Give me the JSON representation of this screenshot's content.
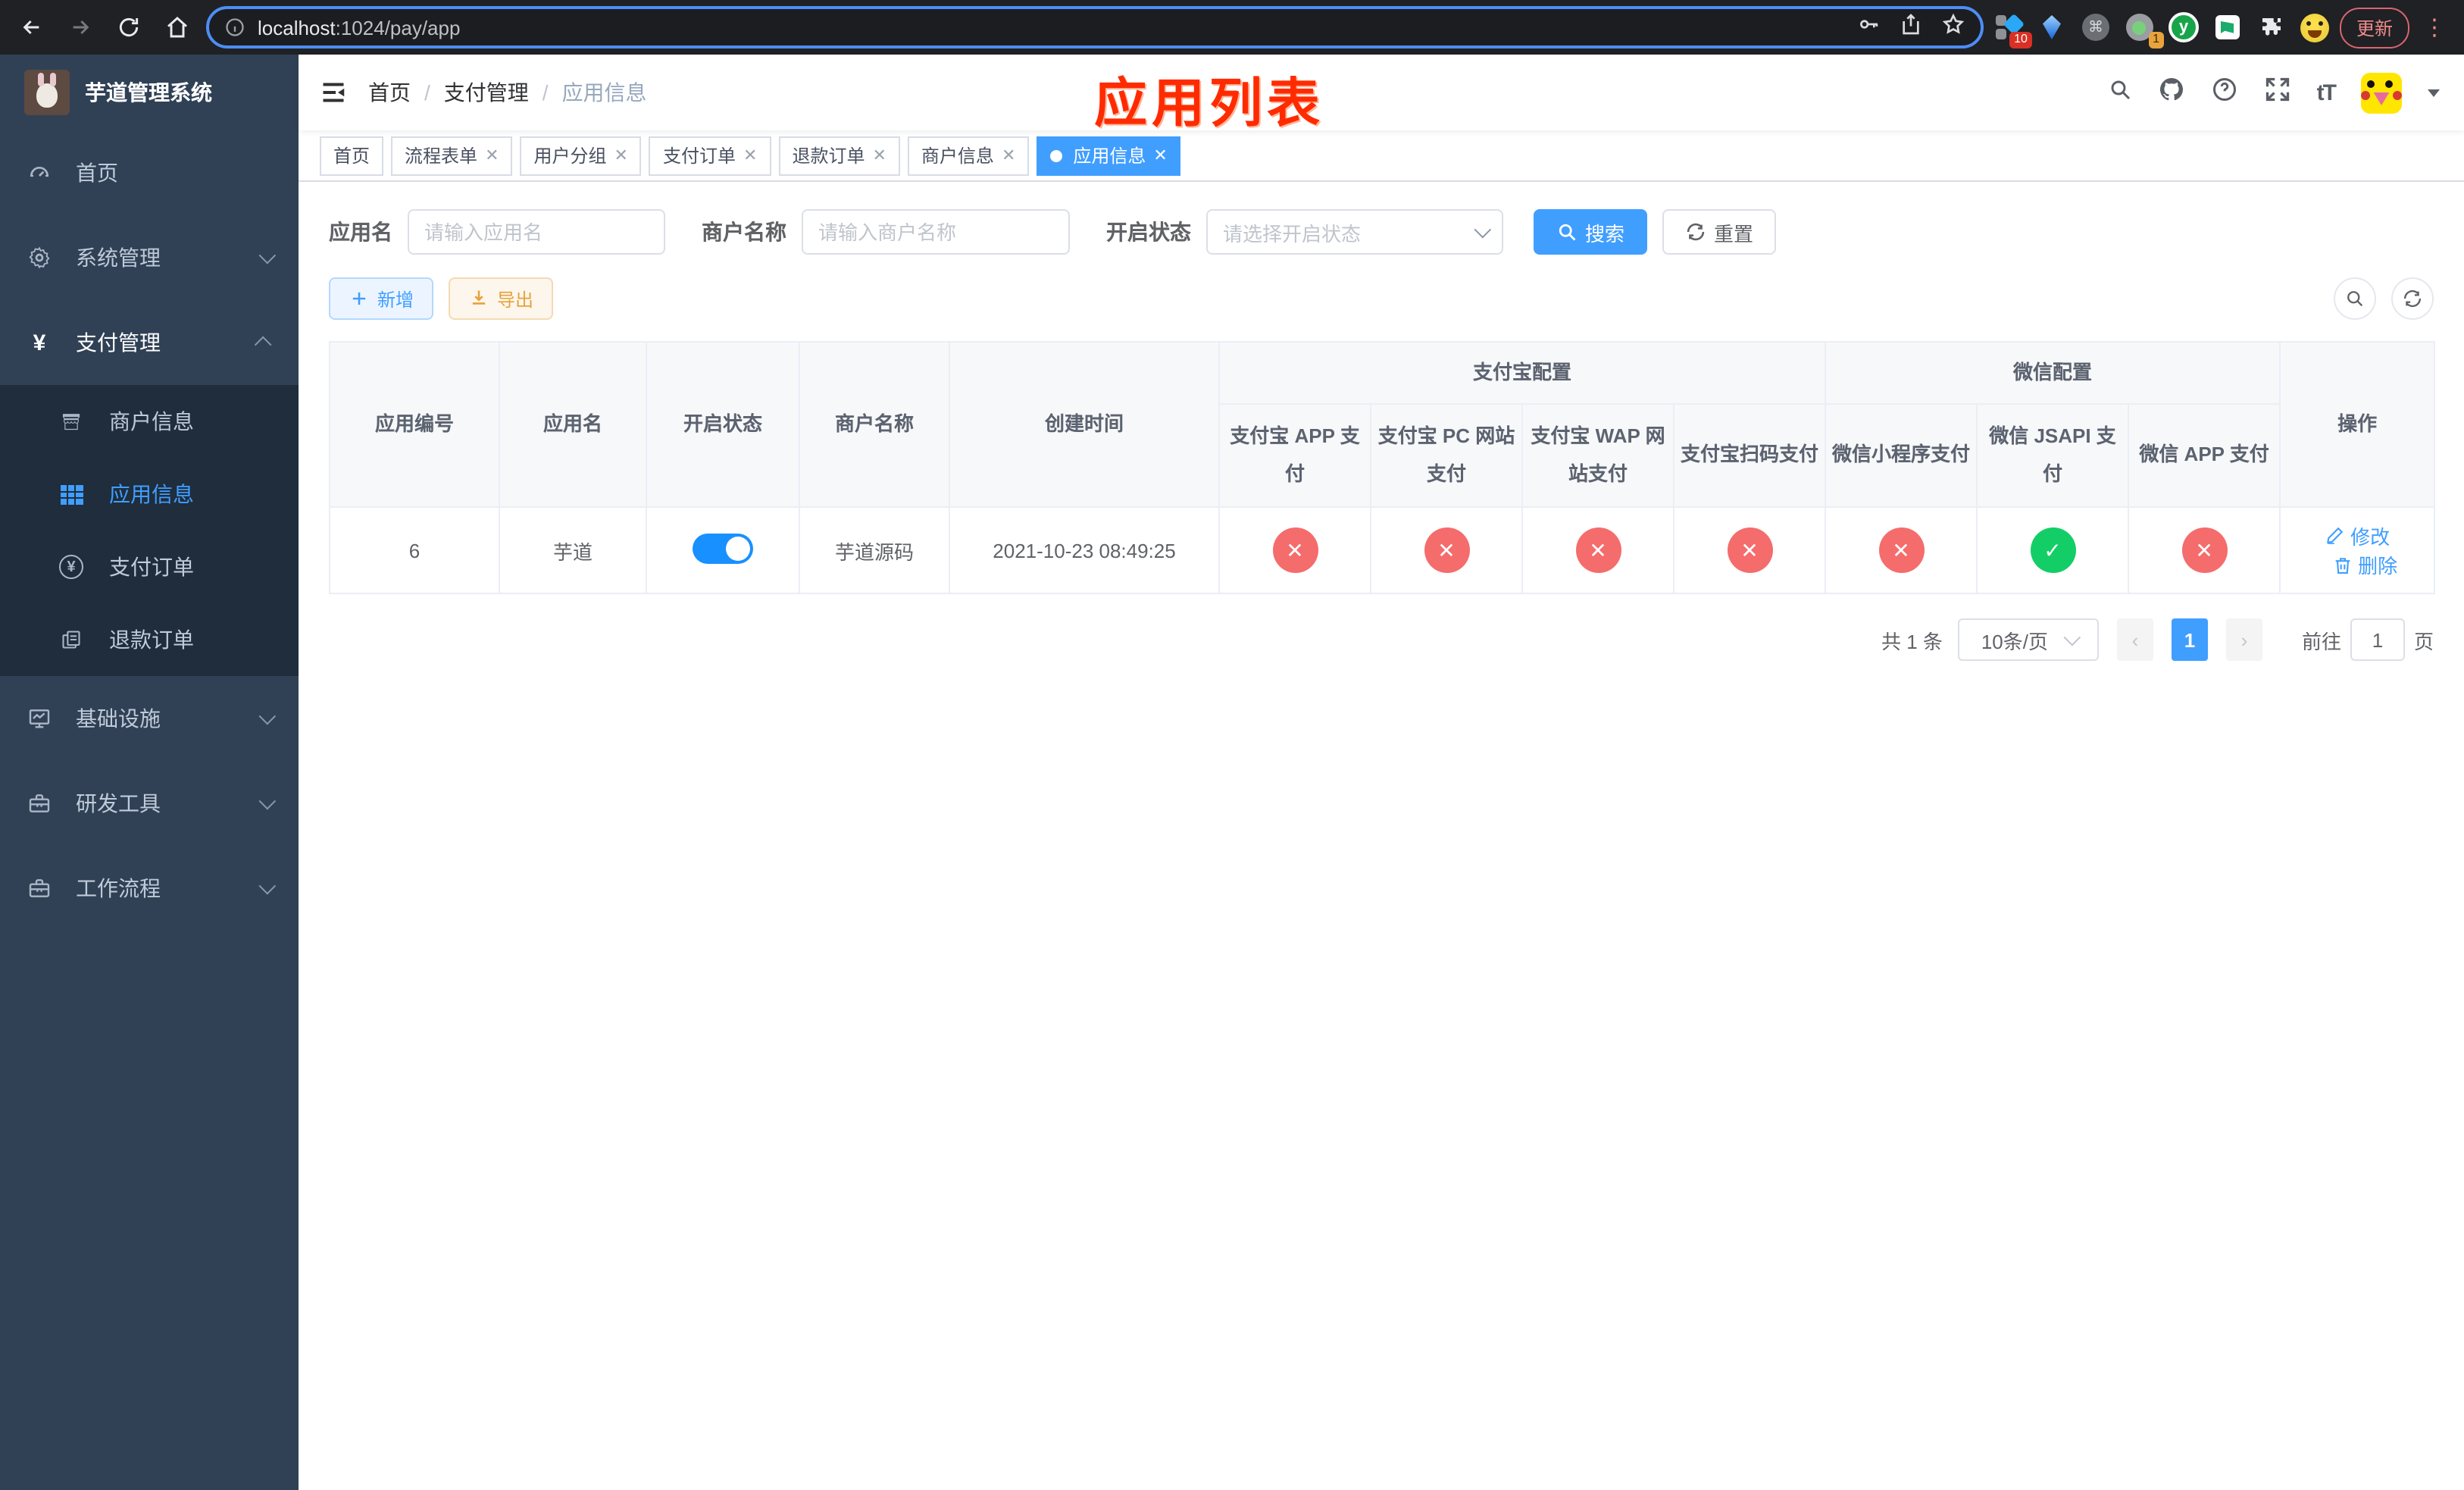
{
  "browser": {
    "url_host": "localhost",
    "url_path": ":1024/pay/app",
    "ext1_badge": "10",
    "ext4_badge": "1",
    "ext5_letter": "y",
    "update_button": "更新"
  },
  "sidebar": {
    "title": "芋道管理系统",
    "menu_home": "首页",
    "menu_system": "系统管理",
    "menu_pay": "支付管理",
    "sub_merchant": "商户信息",
    "sub_app": "应用信息",
    "sub_pay_order": "支付订单",
    "sub_refund_order": "退款订单",
    "menu_infra": "基础设施",
    "menu_dev": "研发工具",
    "menu_workflow": "工作流程"
  },
  "navbar": {
    "breadcrumb_home": "首页",
    "breadcrumb_section": "支付管理",
    "breadcrumb_current": "应用信息",
    "annotation": "应用列表",
    "font_size_icon_text": "tT"
  },
  "tabs": {
    "items": [
      {
        "label": "首页"
      },
      {
        "label": "流程表单"
      },
      {
        "label": "用户分组"
      },
      {
        "label": "支付订单"
      },
      {
        "label": "退款订单"
      },
      {
        "label": "商户信息"
      },
      {
        "label": "应用信息"
      }
    ]
  },
  "search": {
    "app_name_label": "应用名",
    "app_name_placeholder": "请输入应用名",
    "merchant_label": "商户名称",
    "merchant_placeholder": "请输入商户名称",
    "status_label": "开启状态",
    "status_placeholder": "请选择开启状态",
    "search_button": "搜索",
    "reset_button": "重置"
  },
  "toolbar": {
    "add_button": "新增",
    "export_button": "导出"
  },
  "table": {
    "col_app_id": "应用编号",
    "col_app_name": "应用名",
    "col_status": "开启状态",
    "col_merchant": "商户名称",
    "col_created": "创建时间",
    "group_alipay": "支付宝配置",
    "group_wechat": "微信配置",
    "col_op": "操作",
    "pay_cols": [
      "支付宝 APP 支付",
      "支付宝 PC 网站支付",
      "支付宝 WAP 网站支付",
      "支付宝扫码支付",
      "微信小程序支付",
      "微信 JSAPI 支付",
      "微信 APP 支付"
    ],
    "row": {
      "app_id": "6",
      "app_name": "芋道",
      "enabled": true,
      "merchant": "芋道源码",
      "created": "2021-10-23 08:49:25",
      "pay_statuses": [
        "fail",
        "fail",
        "fail",
        "fail",
        "fail",
        "pass",
        "fail"
      ],
      "edit_link": "修改",
      "delete_link": "删除"
    }
  },
  "pagination": {
    "total": "共 1 条",
    "page_size": "10条/页",
    "current_page": "1",
    "goto_label": "前往",
    "goto_value": "1",
    "goto_suffix": "页"
  }
}
